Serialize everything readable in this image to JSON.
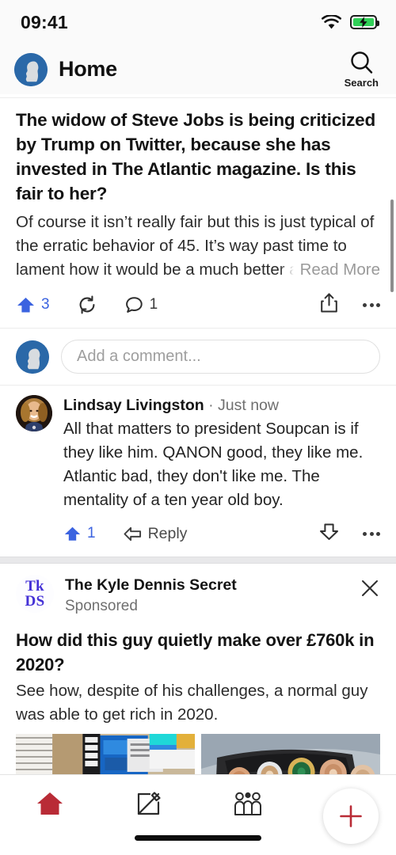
{
  "status_bar": {
    "time": "09:41",
    "wifi_icon": "wifi-icon",
    "battery_icon": "battery-charging-icon"
  },
  "header": {
    "title": "Home",
    "avatar_icon": "quora-user-avatar",
    "search_label": "Search",
    "search_icon": "search-icon"
  },
  "post": {
    "title": "The widow of Steve Jobs is being criticized by Trump on Twitter, because she has invested in The Atlantic magazine. Is this fair to her?",
    "body": "Of course it isn’t really fair but this is just typical of the erratic behavior of 45. It’s way past time to lament how it would be a much better a",
    "read_more": "Read More",
    "upvote_count": "3",
    "comment_count": "1",
    "upvote_icon": "upvote-arrow-icon",
    "repost_icon": "repost-icon",
    "comment_icon": "comment-bubble-icon",
    "share_icon": "share-icon",
    "more_icon": "more-options-icon"
  },
  "composer": {
    "placeholder": "Add a comment...",
    "avatar_icon": "quora-user-avatar"
  },
  "comment": {
    "author": "Lindsay Livingston",
    "separator": "·",
    "time": "Just now",
    "text": "All that matters to president Soupcan is if they like him. QANON good, they like me. Atlantic bad, they don't like me. The mentality of a ten year old boy.",
    "upvote_count": "1",
    "reply_label": "Reply",
    "upvote_icon": "upvote-arrow-icon",
    "reply_icon": "reply-arrow-icon",
    "downvote_icon": "downvote-arrow-icon",
    "more_icon": "more-options-icon",
    "avatar_icon": "commenter-photo-avatar"
  },
  "ad": {
    "logo_line1": "Tk",
    "logo_line2": "DS",
    "advertiser": "The Kyle Dennis Secret",
    "sponsored_label": "Sponsored",
    "close_icon": "close-icon",
    "title": "How did this guy quietly make over £760k in 2020?",
    "description": "See how, despite of his challenges, a normal guy was able to get rich in 2020.",
    "image_left_alt": "desk-with-monitors-photo",
    "image_right_alt": "luxury-watches-photo"
  },
  "fab": {
    "icon": "plus-icon",
    "color": "#b92b36"
  },
  "tab_bar": {
    "items": [
      {
        "name": "home",
        "icon": "home-icon",
        "active": true
      },
      {
        "name": "answer",
        "icon": "pencil-square-icon",
        "active": false
      },
      {
        "name": "spaces",
        "icon": "people-group-icon",
        "active": false
      },
      {
        "name": "notifications",
        "icon": "bell-icon",
        "active": false
      }
    ],
    "active_color": "#b92b36",
    "inactive_color": "#2b2b2b"
  },
  "colors": {
    "upvote_blue": "#3b63e0",
    "quora_red": "#b92b36",
    "avatar_blue": "#2a68a8",
    "ad_logo_purple": "#4431d6"
  }
}
